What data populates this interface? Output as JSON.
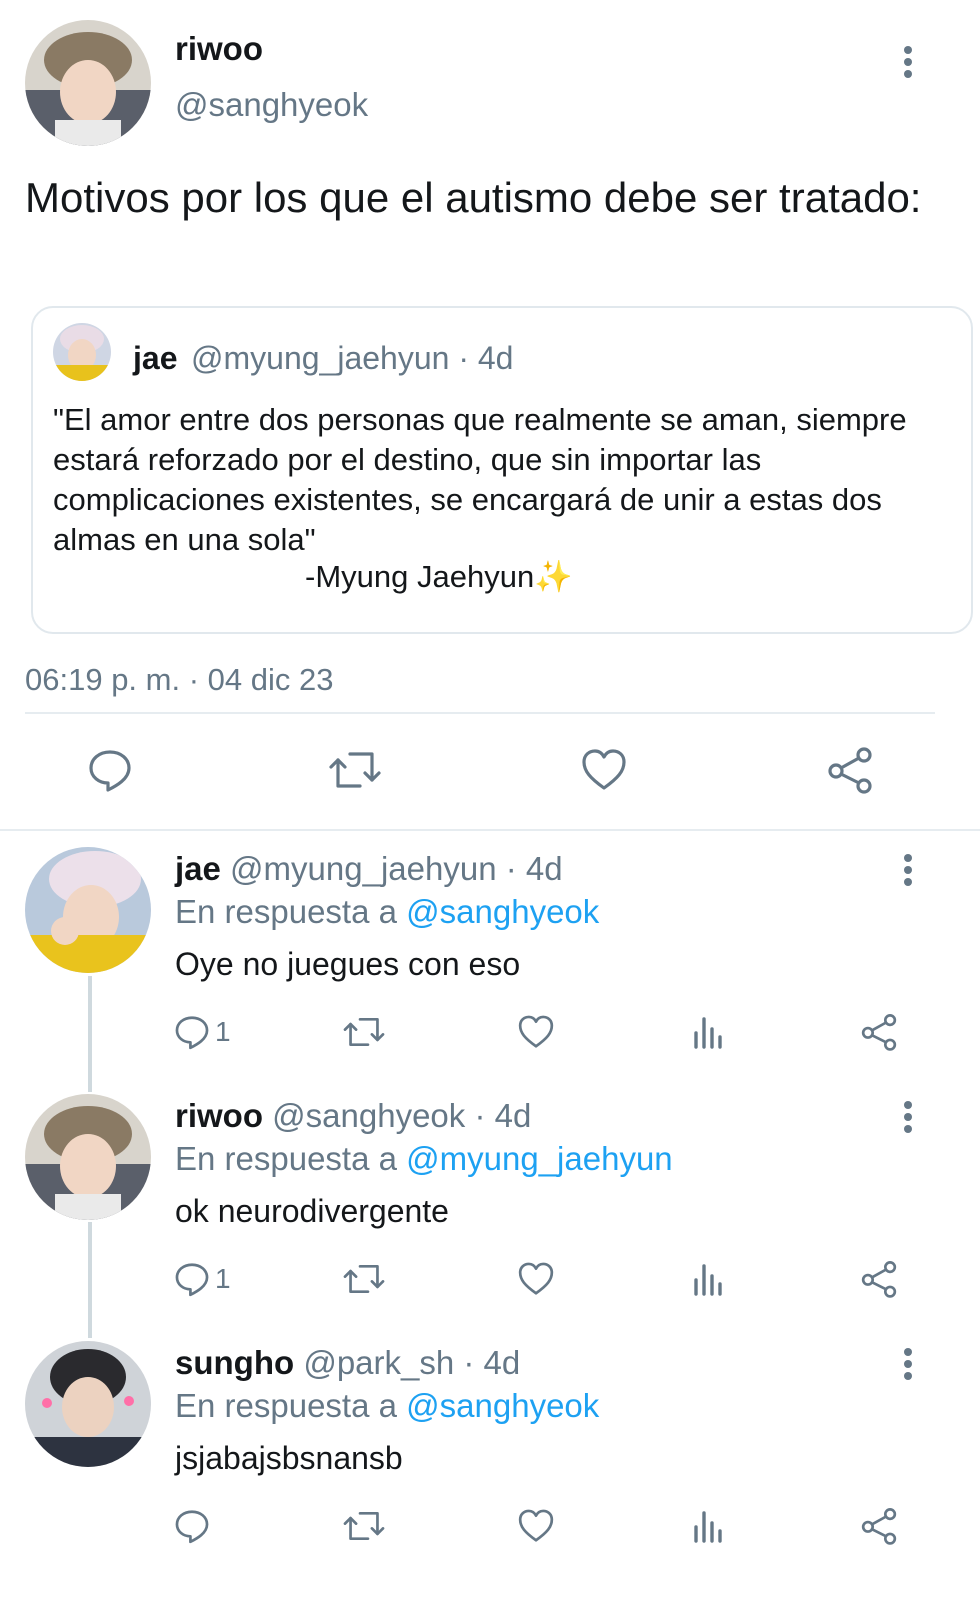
{
  "tweet": {
    "author_name": "riwoo",
    "author_handle": "@sanghyeok",
    "text": "Motivos por los que el autismo debe ser tratado:",
    "timestamp": "06:19 p. m. · 04 dic 23",
    "quoted": {
      "author_name": "jae",
      "meta": "@myung_jaehyun · 4d",
      "text": "\"El amor entre dos personas que realmente se aman, siempre estará reforzado por el destino, que sin importar las complicaciones existentes, se encargará de unir a estas dos almas en una sola\"",
      "signature": "-Myung Jaehyun",
      "signature_emoji": "✨"
    },
    "icons": [
      "reply-icon",
      "retweet-icon",
      "like-icon",
      "share-icon"
    ]
  },
  "replies": [
    {
      "author_name": "jae",
      "meta": "@myung_jaehyun · 4d",
      "reply_prefix": "En respuesta a ",
      "reply_to": "@sanghyeok",
      "text": "Oye no juegues con eso",
      "reply_count": "1"
    },
    {
      "author_name": "riwoo",
      "meta": "@sanghyeok · 4d",
      "reply_prefix": "En respuesta a ",
      "reply_to": "@myung_jaehyun",
      "text": "ok neurodivergente",
      "reply_count": "1"
    },
    {
      "author_name": "sungho",
      "meta": "@park_sh · 4d",
      "reply_prefix": "En respuesta a ",
      "reply_to": "@sanghyeok",
      "text": "jsjabajsbsnansb",
      "reply_count": ""
    }
  ],
  "colors": {
    "text": "#14171a",
    "muted": "#657786",
    "mention": "#1da1f2",
    "border": "#e1e8ed"
  }
}
